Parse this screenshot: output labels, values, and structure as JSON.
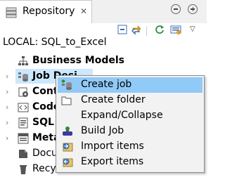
{
  "panel": {
    "tab_title": "Repository",
    "tab_close": "✕",
    "project_label": "LOCAL: SQL_to_Excel",
    "dropdown_glyph": "▽"
  },
  "tree": {
    "items": [
      {
        "label": "Business Models",
        "icon": "business-models-icon",
        "bold": true,
        "expandable": false
      },
      {
        "label": "Job Designs",
        "icon": "job-designs-icon",
        "bold": true,
        "expandable": true,
        "selected": true
      },
      {
        "label": "Contexts",
        "icon": "contexts-icon",
        "bold": true,
        "expandable": true
      },
      {
        "label": "Code",
        "icon": "code-icon",
        "bold": true,
        "expandable": true
      },
      {
        "label": "SQL Templates",
        "icon": "sql-icon",
        "bold": true,
        "expandable": true
      },
      {
        "label": "Metadata",
        "icon": "metadata-icon",
        "bold": true,
        "expandable": true
      },
      {
        "label": "Documentation",
        "icon": "documentation-icon",
        "bold": false,
        "expandable": false
      },
      {
        "label": "Recycle bin",
        "icon": "recycle-bin-icon",
        "bold": false,
        "expandable": false
      }
    ],
    "visible_labels": [
      "Business Models",
      "Job Desi",
      "Cont",
      "Code",
      "SQL",
      "Meta",
      "Docu",
      "Recycle bin"
    ],
    "arrow_glyph": "›"
  },
  "context_menu": {
    "items": [
      {
        "label": "Create job",
        "icon": "create-job-icon",
        "active": true
      },
      {
        "label": "Create folder",
        "icon": "folder-icon",
        "active": false
      },
      {
        "label": "Expand/Collapse",
        "icon": "",
        "active": false
      },
      {
        "label": "Build Job",
        "icon": "build-job-icon",
        "active": false
      },
      {
        "label": "Import items",
        "icon": "import-items-icon",
        "active": false
      },
      {
        "label": "Export items",
        "icon": "export-items-icon",
        "active": false
      }
    ]
  },
  "colors": {
    "selection": "#cce8ff",
    "menu_hover": "#91c9f7",
    "menu_bg": "#f2f2f2"
  }
}
